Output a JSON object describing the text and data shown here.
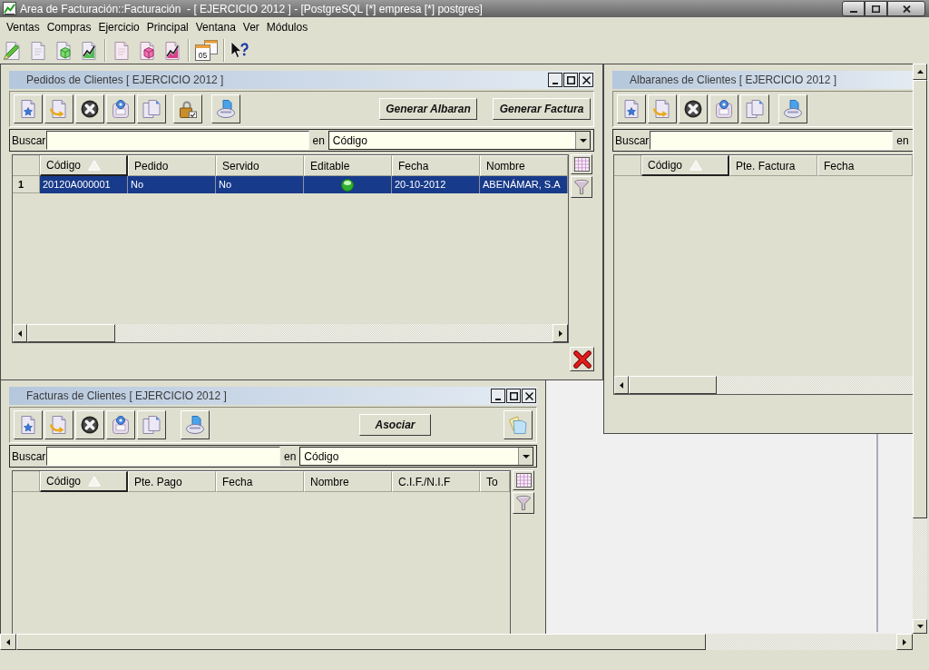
{
  "window": {
    "title": "Area de Facturación::Facturación  - [ EJERCICIO 2012 ] - [PostgreSQL [*] empresa [*] postgres]"
  },
  "menu": [
    "Ventas",
    "Compras",
    "Ejercicio",
    "Principal",
    "Ventana",
    "Ver",
    "Módulos"
  ],
  "toolbar": {
    "calendar_text": "05"
  },
  "subwindows": [
    {
      "title": "Pedidos de Clientes [ EJERCICIO 2012 ]",
      "buttons": [
        "Generar Albaran",
        "Generar Factura"
      ],
      "search": {
        "label": "Buscar",
        "in_label": "en",
        "field": "Código"
      },
      "table": {
        "columns": [
          {
            "label": "Código",
            "sorted": true
          },
          {
            "label": "Pedido",
            "sorted": false
          },
          {
            "label": "Servido",
            "sorted": false
          },
          {
            "label": "Editable",
            "sorted": false
          },
          {
            "label": "Fecha",
            "sorted": false
          },
          {
            "label": "Nombre",
            "sorted": false
          }
        ],
        "rows": [
          {
            "number": "1",
            "selected": true,
            "cells": [
              {
                "kind": "text",
                "text": "20120A000001"
              },
              {
                "kind": "text",
                "text": "No"
              },
              {
                "kind": "text",
                "text": "No"
              },
              {
                "kind": "indicator",
                "on": true
              },
              {
                "kind": "text",
                "text": "20-10-2012"
              },
              {
                "kind": "text",
                "text": "ABENÁMAR, S.A"
              }
            ]
          }
        ]
      }
    },
    {
      "title": "Albaranes de Clientes [ EJERCICIO 2012 ]",
      "search": {
        "label": "Buscar",
        "in_label": "en"
      },
      "table": {
        "columns": [
          {
            "label": "Código",
            "sorted": true
          },
          {
            "label": "Pte. Factura",
            "sorted": false
          },
          {
            "label": "Fecha",
            "sorted": false
          }
        ]
      }
    },
    {
      "title": "Facturas de Clientes [ EJERCICIO 2012 ]",
      "buttons": [
        "Asociar"
      ],
      "search": {
        "label": "Buscar",
        "in_label": "en",
        "field": "Código"
      },
      "table": {
        "columns": [
          {
            "label": "Código",
            "sorted": true
          },
          {
            "label": "Pte. Pago",
            "sorted": false
          },
          {
            "label": "Fecha",
            "sorted": false
          },
          {
            "label": "Nombre",
            "sorted": false
          },
          {
            "label": "C.I.F./N.I.F",
            "sorted": false
          },
          {
            "label": "To",
            "sorted": false
          }
        ]
      }
    }
  ]
}
